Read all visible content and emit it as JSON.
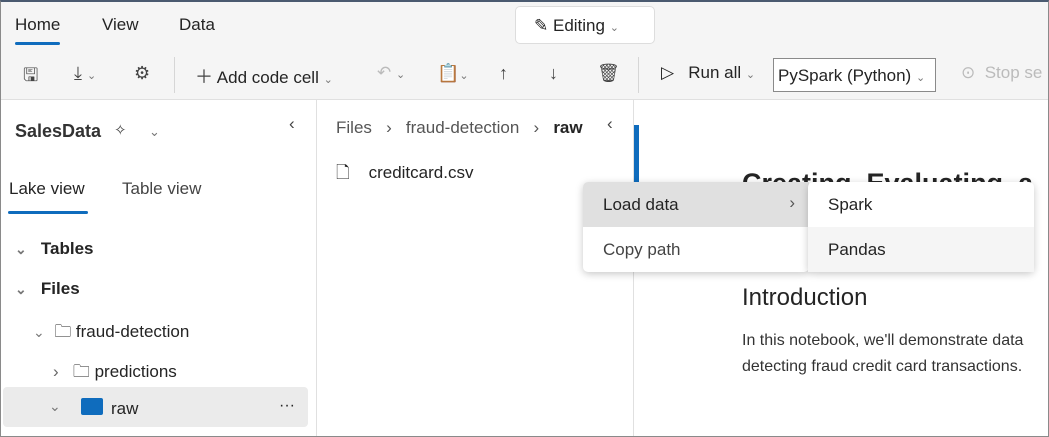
{
  "ribbon": {
    "tabs": [
      "Home",
      "View",
      "Data"
    ],
    "active_tab": "Home",
    "mode_label": "Editing"
  },
  "toolbar": {
    "add_code_cell": "Add code cell",
    "run_all": "Run all",
    "language": "PySpark (Python)",
    "stop_session": "Stop se"
  },
  "explorer": {
    "lakehouse": "SalesData",
    "tabs": [
      "Lake view",
      "Table view"
    ],
    "active_tab": "Lake view",
    "tree": [
      {
        "label": "Tables"
      },
      {
        "label": "Files"
      },
      {
        "label": "fraud-detection"
      },
      {
        "label": "predictions"
      },
      {
        "label": "raw",
        "selected": true
      }
    ]
  },
  "files_pane": {
    "breadcrumb": [
      "Files",
      "fraud-detection",
      "raw"
    ],
    "files": [
      "creditcard.csv"
    ]
  },
  "context_menu": {
    "items": [
      "Load data",
      "Copy path"
    ],
    "submenu": [
      "Spark",
      "Pandas"
    ]
  },
  "notebook": {
    "title_partial": "Creating, Evaluating, a",
    "heading": "Introduction",
    "paragraph_line1": "In this notebook, we'll demonstrate data",
    "paragraph_line2": "detecting fraud credit card transactions."
  },
  "colors": {
    "accent": "#0f6cbd",
    "folder_selected": "#0f6cbd"
  }
}
